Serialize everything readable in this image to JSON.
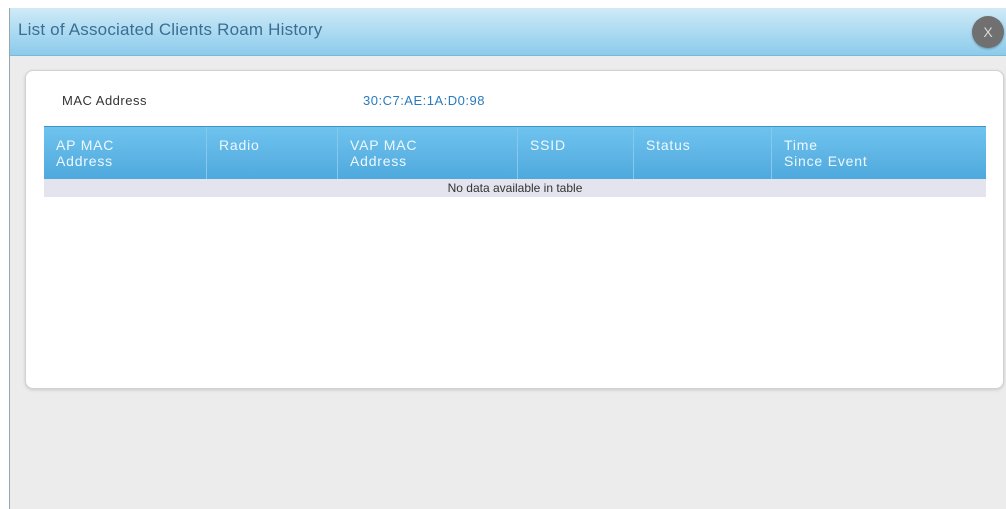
{
  "dialog": {
    "title": "List of Associated Clients Roam History",
    "close_label": "X"
  },
  "client": {
    "mac_label": "MAC Address",
    "mac_value": "30:C7:AE:1A:D0:98"
  },
  "table": {
    "columns": [
      {
        "line1": "AP MAC",
        "line2": "Address"
      },
      {
        "line1": "Radio",
        "line2": ""
      },
      {
        "line1": "VAP MAC",
        "line2": "Address"
      },
      {
        "line1": "SSID",
        "line2": ""
      },
      {
        "line1": "Status",
        "line2": ""
      },
      {
        "line1": "Time",
        "line2": "Since Event"
      }
    ],
    "empty_message": "No data available in table"
  }
}
